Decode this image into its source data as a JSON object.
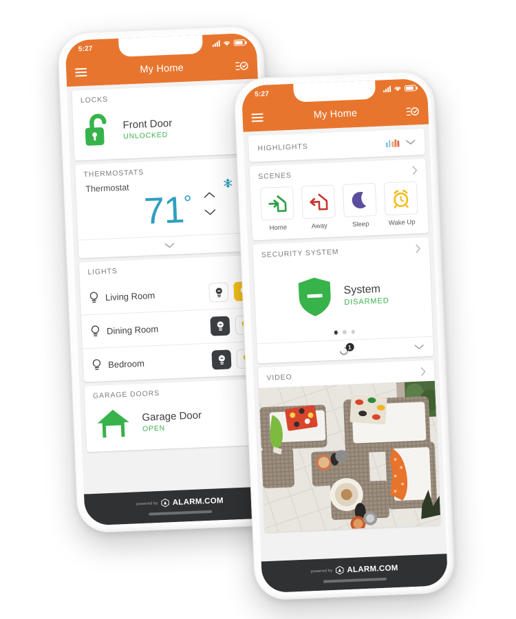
{
  "brand": {
    "powered_by": "powered by",
    "name": "ALARM.COM",
    "accent_orange": "#E8752E",
    "green": "#37B34A",
    "amber": "#F5C21B",
    "teal": "#2F9FC0"
  },
  "phone_back": {
    "status": {
      "time": "5:27",
      "signal_icon": "signal-bars-icon",
      "wifi_icon": "wifi-icon",
      "battery_icon": "battery-icon"
    },
    "nav": {
      "menu_icon": "hamburger-menu-icon",
      "title": "My Home",
      "right_icon": "checklist-check-icon"
    },
    "locks": {
      "header": "LOCKS",
      "icon": "unlocked-padlock-icon",
      "name": "Front Door",
      "state": "UNLOCKED"
    },
    "thermostats": {
      "header": "THERMOSTATS",
      "name": "Thermostat",
      "mode_icon": "snowflake-icon",
      "schedule_icon": "clock-power-icon",
      "temperature": "71",
      "degree": "°",
      "up_icon": "chevron-up-icon",
      "down_icon": "chevron-down-icon",
      "expand_icon": "chevron-down-icon"
    },
    "lights": {
      "header": "LIGHTS",
      "rows": [
        {
          "icon": "bulb-outline-icon",
          "name": "Living Room",
          "off_selected": false,
          "on_selected": true
        },
        {
          "icon": "bulb-outline-icon",
          "name": "Dining Room",
          "off_selected": true,
          "on_selected": false
        },
        {
          "icon": "bulb-outline-icon",
          "name": "Bedroom",
          "off_selected": true,
          "on_selected": false
        }
      ],
      "off_button_icon": "bulb-off-icon",
      "on_button_icon": "bulb-on-icon"
    },
    "garage": {
      "header": "GARAGE DOORS",
      "icon": "garage-door-open-icon",
      "name": "Garage Door",
      "state": "OPEN"
    }
  },
  "phone_front": {
    "status": {
      "time": "5:27",
      "signal_icon": "signal-bars-icon",
      "wifi_icon": "wifi-icon",
      "battery_icon": "battery-icon"
    },
    "nav": {
      "menu_icon": "hamburger-menu-icon",
      "title": "My Home",
      "right_icon": "checklist-check-icon"
    },
    "highlights": {
      "header": "HIGHLIGHTS",
      "bars_icon": "bar-chart-icon",
      "bar_colors": [
        "#5BA8D6",
        "#7FC4E4",
        "#F0A868",
        "#E8815B",
        "#E06B5B"
      ],
      "collapse_icon": "chevron-down-icon"
    },
    "scenes": {
      "header": "SCENES",
      "more_icon": "chevron-right-icon",
      "items": [
        {
          "label": "Home",
          "icon": "scene-home-icon",
          "color": "#2E9E45"
        },
        {
          "label": "Away",
          "icon": "scene-away-icon",
          "color": "#C8352C"
        },
        {
          "label": "Sleep",
          "icon": "scene-sleep-icon",
          "color": "#5B4E9E"
        },
        {
          "label": "Wake Up",
          "icon": "scene-wakeup-icon",
          "color": "#F5BB17"
        }
      ]
    },
    "security": {
      "header": "SECURITY SYSTEM",
      "more_icon": "chevron-right-icon",
      "shield_icon": "shield-disarmed-icon",
      "name": "System",
      "state": "DISARMED",
      "dots_total": 3,
      "dots_active": 1,
      "footer_icon": "sensor-activity-icon",
      "footer_badge": "1",
      "expand_icon": "chevron-down-icon"
    },
    "video": {
      "header": "VIDEO",
      "more_icon": "chevron-right-icon",
      "feed_alt": "outdoor-patio-camera-feed"
    }
  }
}
